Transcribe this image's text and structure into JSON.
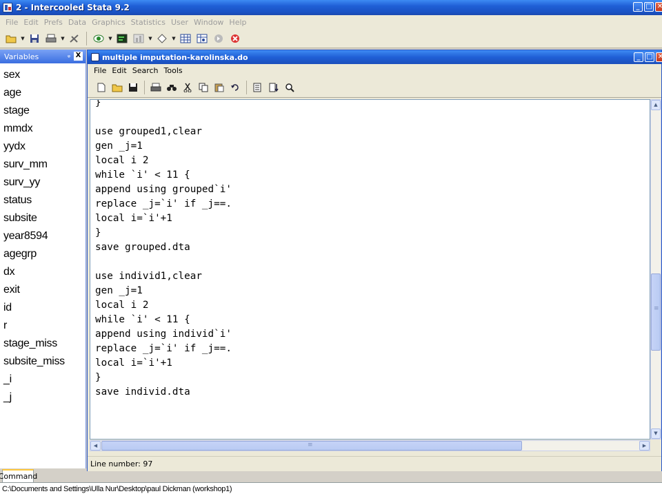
{
  "app": {
    "title": "2 - Intercooled Stata 9.2",
    "menu": [
      "File",
      "Edit",
      "Prefs",
      "Data",
      "Graphics",
      "Statistics",
      "User",
      "Window",
      "Help"
    ],
    "window_buttons": [
      "_",
      "□",
      "✕"
    ],
    "toolbar_icons": [
      "open-icon",
      "save-icon",
      "print-icon",
      "log-icon",
      "viewer-icon",
      "results-icon",
      "graph-icon",
      "dofile-icon",
      "data-editor-icon",
      "data-browser-icon",
      "more-icon",
      "break-icon"
    ]
  },
  "variables_panel": {
    "title": "Variables",
    "pin": "ᵩ",
    "close": "X",
    "items": [
      "sex",
      "age",
      "stage",
      "mmdx",
      "yydx",
      "surv_mm",
      "surv_yy",
      "status",
      "subsite",
      "year8594",
      "agegrp",
      "dx",
      "exit",
      "id",
      "r",
      "stage_miss",
      "subsite_miss",
      "_i",
      "_j"
    ]
  },
  "editor": {
    "title": "multiple imputation-karolinska.do",
    "menu": [
      "File",
      "Edit",
      "Search",
      "Tools"
    ],
    "toolbar_icons": [
      "new-icon",
      "open-icon",
      "save-icon",
      "print-icon",
      "find-icon",
      "cut-icon",
      "copy-icon",
      "paste-icon",
      "undo-icon",
      "do-current-icon",
      "run-icon",
      "preview-icon"
    ],
    "code": "}\n\nuse grouped1,clear\ngen _j=1\nlocal i 2\nwhile `i' < 11 {\nappend using grouped`i'\nreplace _j=`i' if _j==.\nlocal i=`i'+1\n}\nsave grouped.dta\n\nuse individ1,clear\ngen _j=1\nlocal i 2\nwhile `i' < 11 {\nappend using individ`i'\nreplace _j=`i' if _j==.\nlocal i=`i'+1\n}\nsave individ.dta",
    "status": "Line number: 97"
  },
  "command": {
    "tab_label": "Command",
    "path": "C:\\Documents and Settings\\Ulla Nur\\Desktop\\paul Dickman (workshop1)"
  }
}
